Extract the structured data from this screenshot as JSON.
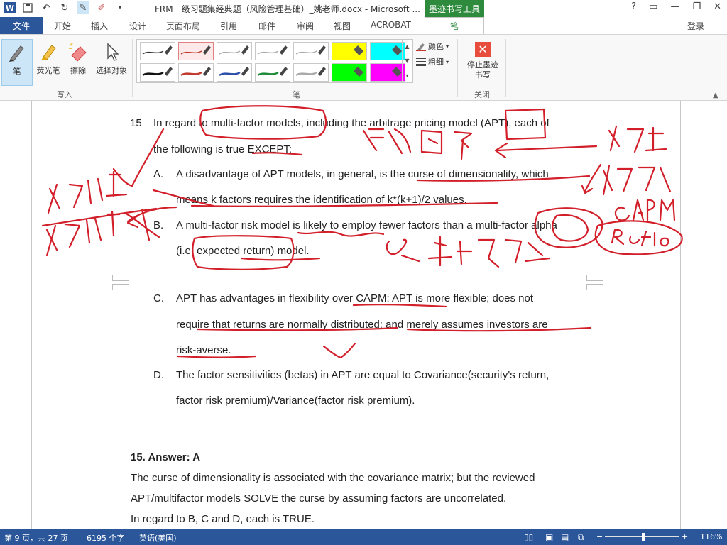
{
  "window": {
    "title": "FRM一级习题集经典题（风险管理基础）_姚老师.docx - Microsoft ...",
    "context_tab_title": "墨迹书写工具",
    "controls": [
      "?",
      "▭",
      "—",
      "❐",
      "✕"
    ]
  },
  "tabs": {
    "file": "文件",
    "items": [
      "开始",
      "插入",
      "设计",
      "页面布局",
      "引用",
      "邮件",
      "审阅",
      "视图",
      "ACROBAT"
    ],
    "active": "笔",
    "login": "登录"
  },
  "ribbon": {
    "write_buttons": [
      {
        "label": "笔",
        "icon": "pen-icon",
        "active": true
      },
      {
        "label": "荧光笔",
        "icon": "highlighter-icon",
        "active": false
      },
      {
        "label": "擦除",
        "icon": "eraser-icon",
        "active": false
      },
      {
        "label": "选择对象",
        "icon": "select-arrow-icon",
        "active": false
      }
    ],
    "write_group_label": "写入",
    "pen_group_label": "笔",
    "close_group_label": "关闭",
    "pen_styles_row1": [
      "#333333",
      "#c0392b",
      "#aaaaaa",
      "#aaaaaa",
      "#aaaaaa",
      "#ffff00",
      "#00ffff"
    ],
    "pen_styles_row2": [
      "#111111",
      "#c0392b",
      "#2b4fa8",
      "#1f8a3a",
      "#aaaaaa",
      "#00ff00",
      "#ff00ff"
    ],
    "color_label": "颜色",
    "thickness_label": "粗细",
    "stop_label": "停止墨迹书写"
  },
  "document": {
    "q_number": "15",
    "q_line1": "In regard to multi-factor models, including the arbitrage pricing model (APT), each of",
    "q_line2": "the following is true EXCEPT:",
    "a_letter": "A.",
    "a_line1": "A disadvantage of APT models, in general, is the curse of dimensionality, which",
    "a_line2": "means k factors requires the identification of k*(k+1)/2 values.",
    "b_letter": "B.",
    "b_line1": "A multi-factor risk model is likely to employ fewer factors than a multi-factor alpha",
    "b_line2": "(i.e. expected return) model.",
    "c_letter": "C.",
    "c_line1": "APT has advantages in flexibility over CAPM: APT is more flexible; does not",
    "c_line2": "require that returns are normally distributed; and merely assumes investors are",
    "c_line3": "risk-averse.",
    "d_letter": "D.",
    "d_line1": "The factor sensitivities (betas) in APT are equal to Covariance(security's return,",
    "d_line2": "factor risk premium)/Variance(factor risk premium).",
    "answer_title": "15.  Answer: A",
    "ans_line1": "The curse of dimensionality is associated with the covariance matrix; but the reviewed",
    "ans_line2": "APT/multifactor models SOLVE the curse by assuming factors are uncorrelated.",
    "ans_line3": "In regard to B, C and D, each is TRUE."
  },
  "status": {
    "page": "第 9 页，共 27 页",
    "words": "6195 个字",
    "language": "英语(美国)",
    "zoom": "116%",
    "zoom_minus": "−",
    "zoom_plus": "+"
  }
}
